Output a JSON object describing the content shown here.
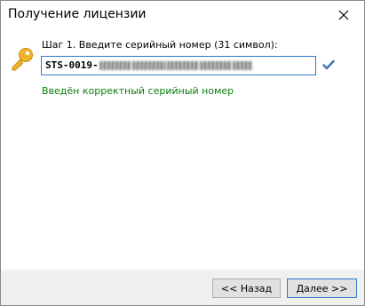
{
  "window": {
    "title": "Получение лицензии"
  },
  "step": {
    "label": "Шаг 1. Введите серийный номер (31 символ):",
    "serial_prefix": "STS-0019-"
  },
  "status": {
    "message": "Введён корректный серийный номер"
  },
  "buttons": {
    "back_label": "<< Назад",
    "next_label": "Далее >>"
  },
  "colors": {
    "success_text": "#0a7d0a",
    "accent": "#3078d0",
    "key_icon": "#f0b428",
    "check_icon": "#3f74b8"
  },
  "icons": {
    "key": "key-icon",
    "valid": "checkmark-icon",
    "close": "close-icon"
  }
}
